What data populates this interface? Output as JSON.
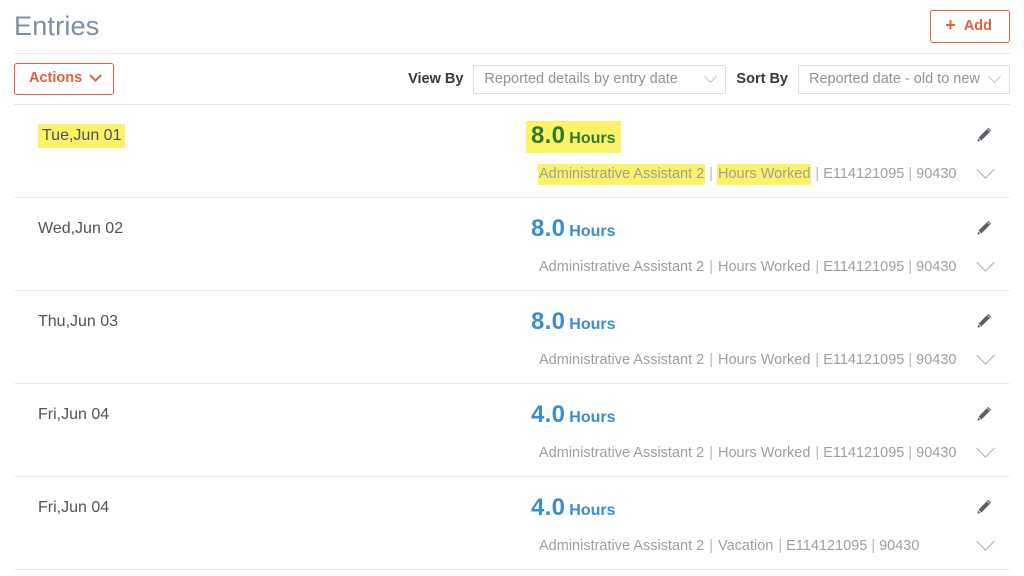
{
  "header": {
    "title": "Entries",
    "add_label": "Add",
    "add_icon": "plus-icon"
  },
  "toolbar": {
    "actions_label": "Actions",
    "actions_icon": "chevron-down-icon",
    "view_by_label": "View By",
    "view_by_value": "Reported details by entry date",
    "sort_by_label": "Sort By",
    "sort_by_value": "Reported date - old to new"
  },
  "colors": {
    "accent_orange": "#e0603a",
    "hours_blue": "#3c8dcd",
    "hours_green": "#2f7a33",
    "highlight_yellow": "#fbf267",
    "title_gray": "#7a8fa3",
    "meta_gray": "#9aa0a6"
  },
  "entries": [
    {
      "date": "Tue,Jun 01",
      "hours": "8.0",
      "hours_unit": "Hours",
      "position": "Administrative Assistant 2",
      "pay_code": "Hours Worked",
      "employee_id": "E114121095",
      "cost_center": "90430",
      "edit_icon": "pencil-icon",
      "expand_icon": "chevron-down-icon"
    },
    {
      "date": "Wed,Jun 02",
      "hours": "8.0",
      "hours_unit": "Hours",
      "position": "Administrative Assistant 2",
      "pay_code": "Hours Worked",
      "employee_id": "E114121095",
      "cost_center": "90430",
      "edit_icon": "pencil-icon",
      "expand_icon": "chevron-down-icon"
    },
    {
      "date": "Thu,Jun 03",
      "hours": "8.0",
      "hours_unit": "Hours",
      "position": "Administrative Assistant 2",
      "pay_code": "Hours Worked",
      "employee_id": "E114121095",
      "cost_center": "90430",
      "edit_icon": "pencil-icon",
      "expand_icon": "chevron-down-icon"
    },
    {
      "date": "Fri,Jun 04",
      "hours": "4.0",
      "hours_unit": "Hours",
      "position": "Administrative Assistant 2",
      "pay_code": "Hours Worked",
      "employee_id": "E114121095",
      "cost_center": "90430",
      "edit_icon": "pencil-icon",
      "expand_icon": "chevron-down-icon"
    },
    {
      "date": "Fri,Jun 04",
      "hours": "4.0",
      "hours_unit": "Hours",
      "position": "Administrative Assistant 2",
      "pay_code": "Vacation",
      "employee_id": "E114121095",
      "cost_center": "90430",
      "edit_icon": "pencil-icon",
      "expand_icon": "chevron-down-icon"
    }
  ],
  "separator": "|"
}
